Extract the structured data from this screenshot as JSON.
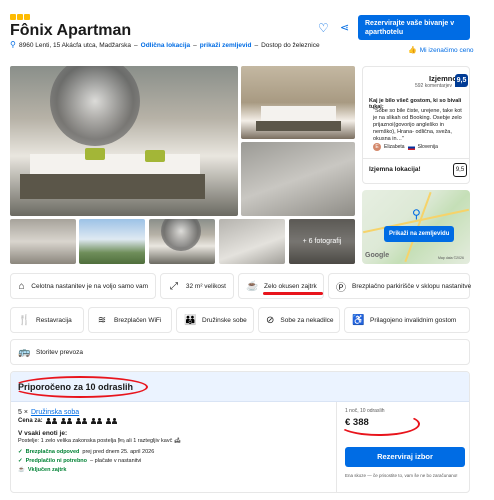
{
  "header": {
    "stars": 3,
    "title": "Fônix Apartman",
    "address": "8960 Lenti, 15 Akácfa utca, Madžarska",
    "location_link": "Odlična lokacija",
    "map_link": "prikaži zemljevid",
    "station_text": "Dostop do železnice",
    "reserve_label": "Rezervirajte vaše bivanje v aparthotelu",
    "price_match": "Mi izenačimo ceno"
  },
  "gallery": {
    "more_photos": "+ 6 fotografij"
  },
  "review": {
    "label": "Izjemno",
    "count": "592 komentarjev",
    "score": "9,5",
    "headline": "Kaj je bilo všeč gostom, ki so bivali tukaj:",
    "quote": "\"Sobe so bile čiste, urejene, take kot je na slikah od Booking. Osebje zelo prijaznoi(govorijo angleško in nemško), Hrana- odlična, sveža, okusna in…\"",
    "user_initial": "E",
    "user_name": "Elizabeta",
    "user_country": "Slovenija",
    "location_label": "Izjemna lokacija!",
    "location_score": "9,5"
  },
  "map": {
    "button": "Prikaži na zemljevidu",
    "google": "Google",
    "data_label": "Map data ©2026"
  },
  "facilities": [
    {
      "icon": "house-icon",
      "glyph": "⌂",
      "label": "Celotna nastanitev je na voljo samo vam"
    },
    {
      "icon": "size-icon",
      "glyph": "⤢",
      "label": "32 m² velikost"
    },
    {
      "icon": "coffee-cup-icon",
      "glyph": "☕",
      "label": "Zelo okusen zajtrk"
    },
    {
      "icon": "parking-icon",
      "glyph": "Ⓟ",
      "label": "Brezplačno parkirišče v sklopu nastanitve"
    },
    {
      "icon": "restaurant-icon",
      "glyph": "🍴",
      "label": "Restavracija"
    },
    {
      "icon": "wifi-icon",
      "glyph": "≋",
      "label": "Brezplačen WiFi"
    },
    {
      "icon": "family-icon",
      "glyph": "👪",
      "label": "Družinske sobe"
    },
    {
      "icon": "no-smoking-icon",
      "glyph": "⊘",
      "label": "Sobe za nekadilce"
    },
    {
      "icon": "accessible-icon",
      "glyph": "♿",
      "label": "Prilagojeno invalidnim gostom"
    },
    {
      "icon": "shuttle-icon",
      "glyph": "🚌",
      "label": "Storitev prevoza"
    }
  ],
  "recommendation": {
    "title": "Priporočeno za 10 odraslih",
    "room_count": "5 ×",
    "room_name": "Družinska soba",
    "price_for": "Cena za:",
    "unit_head": "V vsaki enoti je:",
    "beds": "Postelje: 1 zelo velika zakonska postelja 🛏 ali 1 raztegljiv kavč 🛋",
    "feature1_em": "Brezplačna odpoved",
    "feature1_rest": "prej pred dnem 25. april 2026",
    "feature2_em": "Predplačilo ni potrebno",
    "feature2_rest": "– plačate v nastanitvi",
    "feature3": "Vključen zajtrk",
    "nights": "1 noč, 10 odraslih",
    "price": "€ 388",
    "choose_button": "Rezerviraj izbor",
    "fine_print": "Ena skoze — če prisostite to, vam še ne bo zaračunano!"
  }
}
